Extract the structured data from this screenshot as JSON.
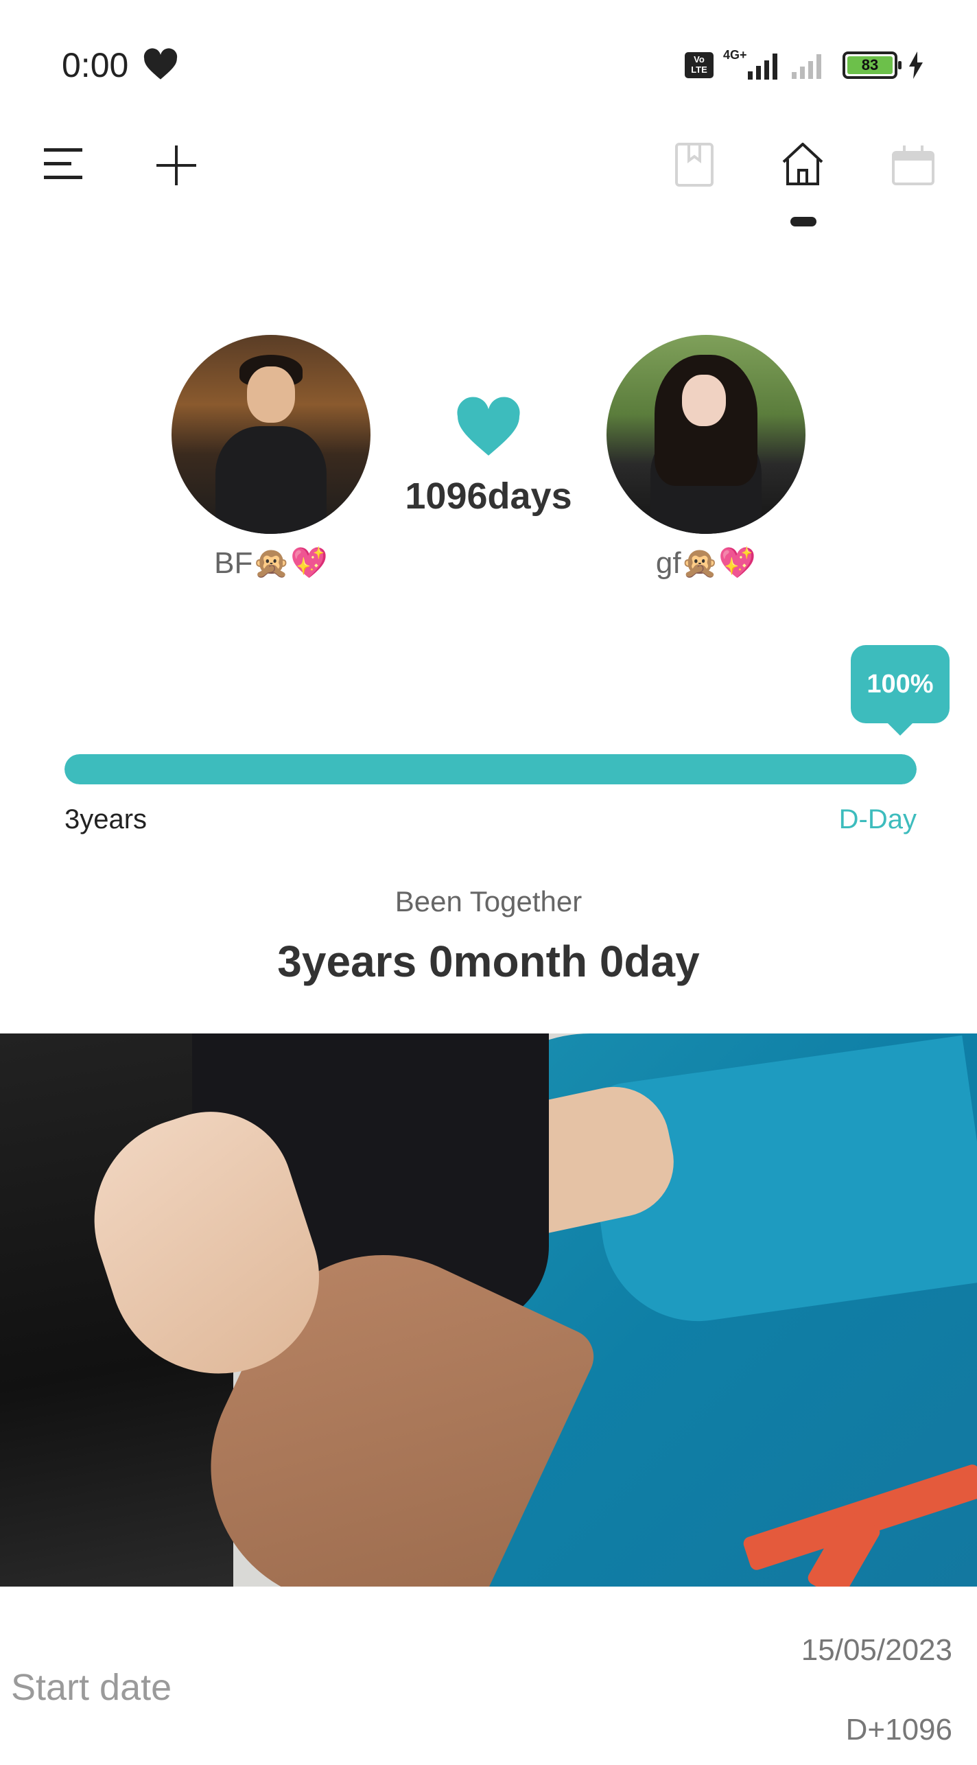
{
  "status_bar": {
    "time": "0:00",
    "network": "4G+",
    "volte": "Vo LTE",
    "battery": "83"
  },
  "toolbar": {
    "menu_icon": "menu-icon",
    "add_icon": "plus-icon",
    "tabs": [
      "bookmark-icon",
      "home-icon",
      "calendar-icon"
    ],
    "active_tab": "home"
  },
  "couple": {
    "bf_name": "BF🙊💖",
    "gf_name": "gf🙊💖",
    "days": "1096days"
  },
  "progress": {
    "badge": "100%",
    "percent": 100,
    "start_label": "3years",
    "end_label": "D-Day"
  },
  "together": {
    "label": "Been Together",
    "value": "3years 0month 0day"
  },
  "footer": {
    "start_date_label": "Start date",
    "start_date": "15/05/2023",
    "dday": "D+1096"
  },
  "colors": {
    "accent": "#3dbcbd",
    "text_primary": "#333333",
    "text_secondary": "#666666"
  }
}
